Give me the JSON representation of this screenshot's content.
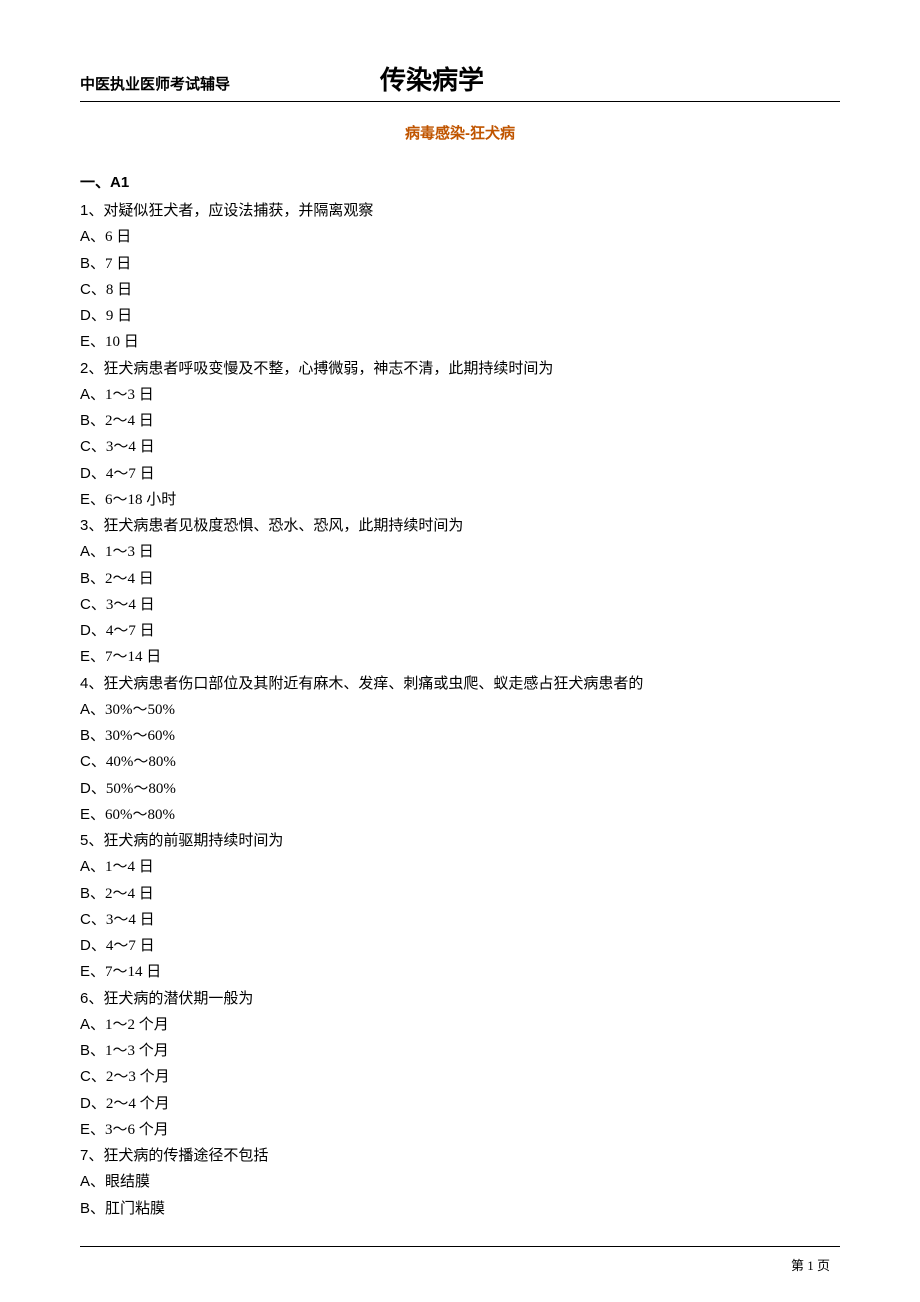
{
  "header": {
    "left": "中医执业医师考试辅导",
    "title": "传染病学"
  },
  "subtitle": "病毒感染-狂犬病",
  "section": {
    "label": "一、A1"
  },
  "questions": [
    {
      "num": "1",
      "text": "对疑似狂犬者，应设法捕获，并隔离观察",
      "options": [
        {
          "letter": "A",
          "text": "6 日"
        },
        {
          "letter": "B",
          "text": "7 日"
        },
        {
          "letter": "C",
          "text": "8 日"
        },
        {
          "letter": "D",
          "text": "9 日"
        },
        {
          "letter": "E",
          "text": "10 日"
        }
      ]
    },
    {
      "num": "2",
      "text": "狂犬病患者呼吸变慢及不整，心搏微弱，神志不清，此期持续时间为",
      "options": [
        {
          "letter": "A",
          "text": "1～3 日"
        },
        {
          "letter": "B",
          "text": "2～4 日"
        },
        {
          "letter": "C",
          "text": "3～4 日"
        },
        {
          "letter": "D",
          "text": "4～7 日"
        },
        {
          "letter": "E",
          "text": "6～18 小时"
        }
      ]
    },
    {
      "num": "3",
      "text": "狂犬病患者见极度恐惧、恐水、恐风，此期持续时间为",
      "options": [
        {
          "letter": "A",
          "text": "1～3 日"
        },
        {
          "letter": "B",
          "text": "2～4 日"
        },
        {
          "letter": "C",
          "text": "3～4 日"
        },
        {
          "letter": "D",
          "text": "4～7 日"
        },
        {
          "letter": "E",
          "text": "7～14 日"
        }
      ]
    },
    {
      "num": "4",
      "text": "狂犬病患者伤口部位及其附近有麻木、发痒、刺痛或虫爬、蚁走感占狂犬病患者的",
      "options": [
        {
          "letter": "A",
          "text": "30%～50%"
        },
        {
          "letter": "B",
          "text": "30%～60%"
        },
        {
          "letter": "C",
          "text": "40%～80%"
        },
        {
          "letter": "D",
          "text": "50%～80%"
        },
        {
          "letter": "E",
          "text": "60%～80%"
        }
      ]
    },
    {
      "num": "5",
      "text": "狂犬病的前驱期持续时间为",
      "options": [
        {
          "letter": "A",
          "text": "1～4 日"
        },
        {
          "letter": "B",
          "text": "2～4 日"
        },
        {
          "letter": "C",
          "text": "3～4 日"
        },
        {
          "letter": "D",
          "text": "4～7 日"
        },
        {
          "letter": "E",
          "text": "7～14 日"
        }
      ]
    },
    {
      "num": "6",
      "text": "狂犬病的潜伏期一般为",
      "options": [
        {
          "letter": "A",
          "text": "1～2 个月"
        },
        {
          "letter": "B",
          "text": "1～3 个月"
        },
        {
          "letter": "C",
          "text": "2～3 个月"
        },
        {
          "letter": "D",
          "text": "2～4 个月"
        },
        {
          "letter": "E",
          "text": "3～6 个月"
        }
      ]
    },
    {
      "num": "7",
      "text": "狂犬病的传播途径不包括",
      "options": [
        {
          "letter": "A",
          "text": "眼结膜"
        },
        {
          "letter": "B",
          "text": "肛门粘膜"
        }
      ]
    }
  ],
  "footer": {
    "pageLabel": "第 1 页"
  }
}
